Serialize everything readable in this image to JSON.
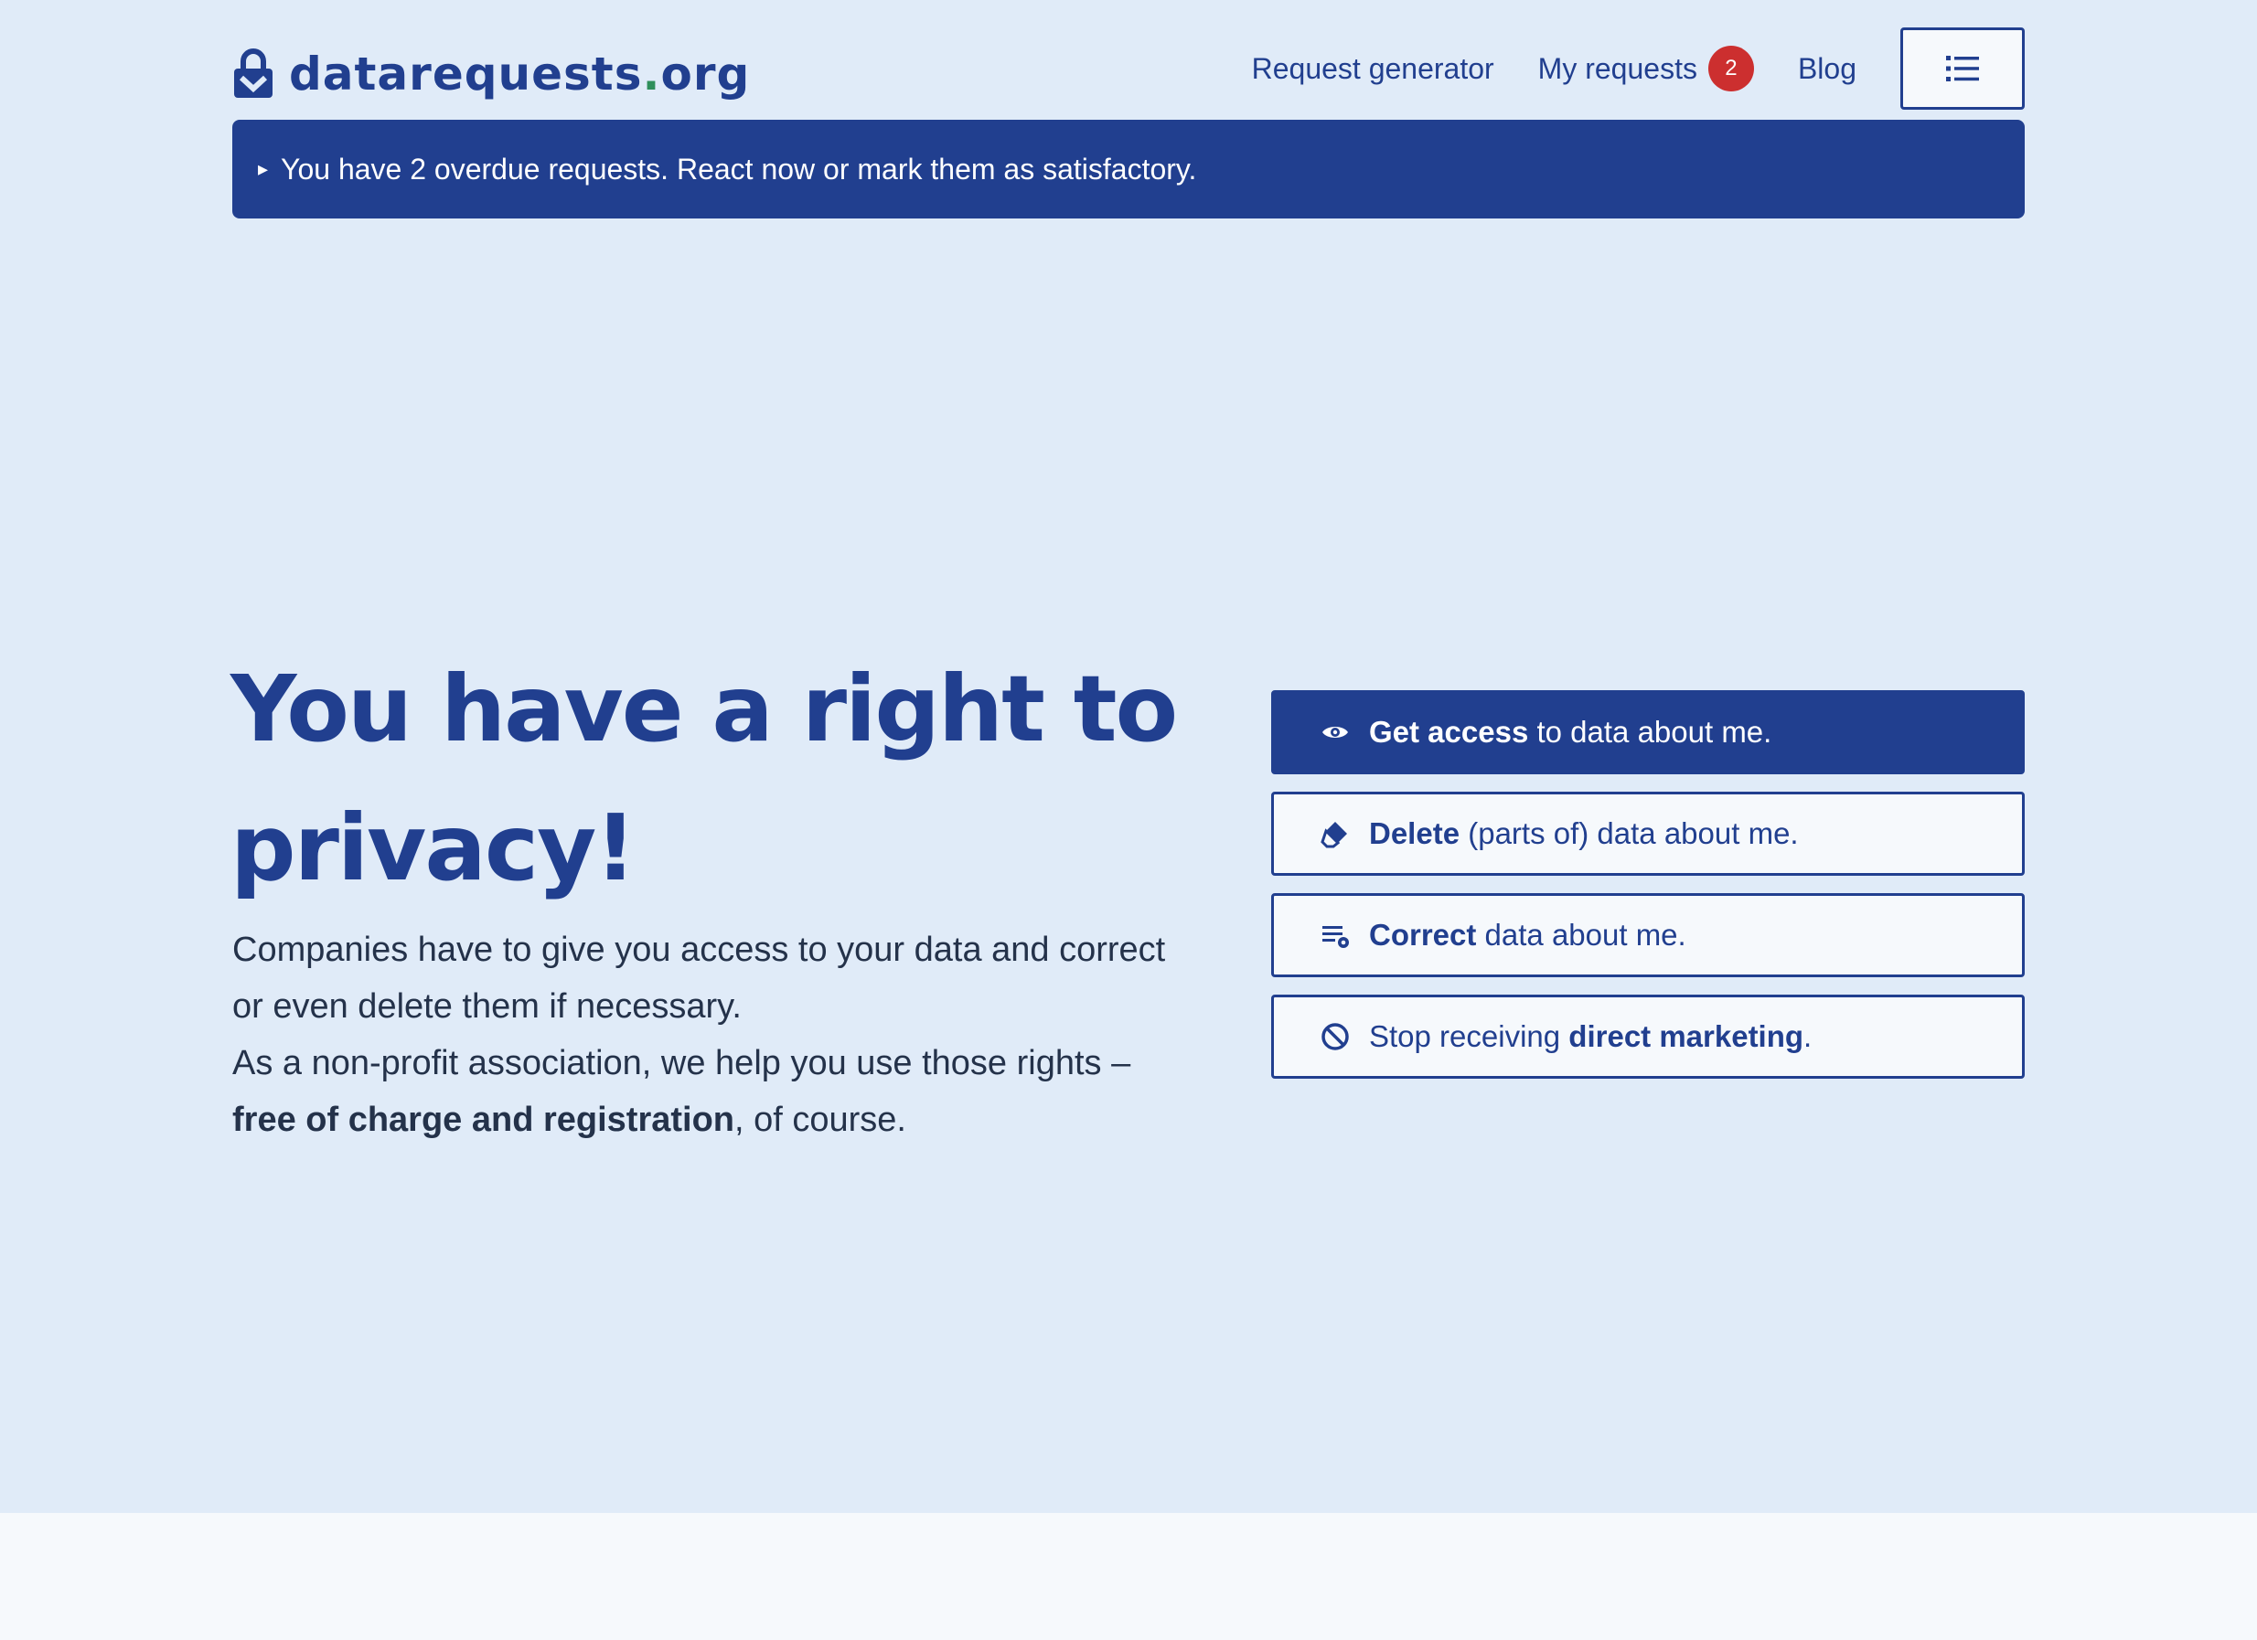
{
  "header": {
    "logo_name": "datarequests",
    "logo_dot": ".",
    "logo_tld": "org",
    "nav": {
      "request_generator": "Request generator",
      "my_requests": "My requests",
      "my_requests_count": "2",
      "blog": "Blog"
    },
    "menu_icon": "list-icon"
  },
  "banner": {
    "arrow": "▸",
    "text": "You have 2 overdue requests. React now or mark them as satisfactory."
  },
  "hero": {
    "title": "You have a right to privacy!",
    "line1": "Companies have to give you access to your data and correct or even delete them if necessary.",
    "line2_start": "As a non-profit association, we help you use those rights – ",
    "line2_bold": "free of charge and registration",
    "line2_end": ", of course."
  },
  "actions": [
    {
      "icon": "eye-icon",
      "pre": "",
      "bold": "Get access",
      "post": " to data about me."
    },
    {
      "icon": "eraser-icon",
      "pre": "",
      "bold": "Delete",
      "post": " (parts of) data about me."
    },
    {
      "icon": "edit-list-icon",
      "pre": "",
      "bold": "Correct",
      "post": " data about me."
    },
    {
      "icon": "block-icon",
      "pre": "Stop receiving ",
      "bold": "direct marketing",
      "post": "."
    }
  ],
  "colors": {
    "brand": "#213f8f",
    "hero_background": "#e0ebf8",
    "page_background": "#f6f9fc",
    "badge": "#cc2f2f",
    "logo_dot": "#2f8f5b"
  }
}
